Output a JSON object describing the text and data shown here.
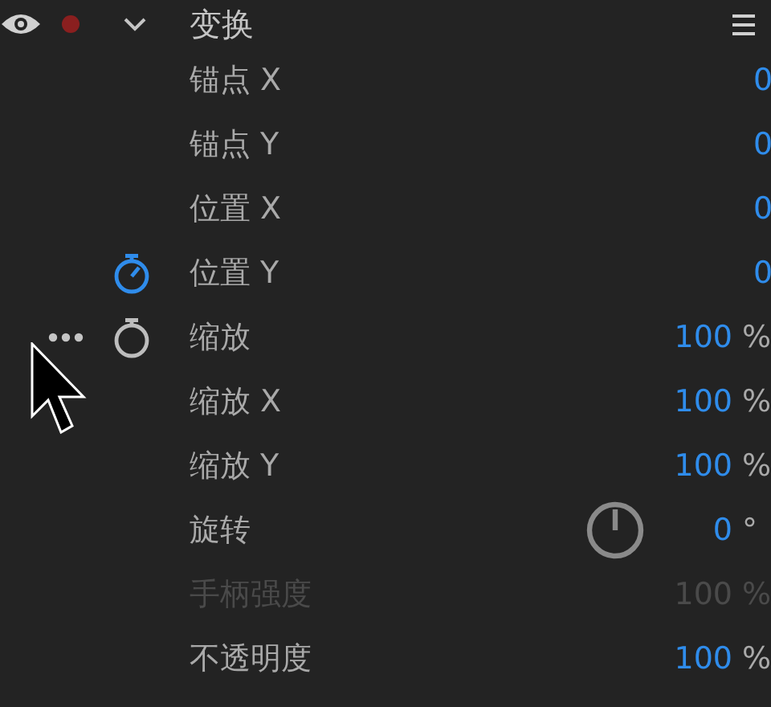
{
  "effect": {
    "title": "变换",
    "visible": true,
    "expanded": true
  },
  "properties": [
    {
      "label": "锚点 X",
      "value": "0",
      "disabled": false
    },
    {
      "label": "锚点 Y",
      "value": "0",
      "disabled": false
    },
    {
      "label": "位置 X",
      "value": "0",
      "disabled": false
    },
    {
      "label": "位置 Y",
      "value": "0",
      "stopwatch": {
        "on": true
      },
      "disabled": false
    },
    {
      "label": "缩放",
      "value": "100",
      "unit": "%",
      "stopwatch": {
        "on": false
      },
      "more": true,
      "disabled": false
    },
    {
      "label": "缩放 X",
      "value": "100",
      "unit": "%",
      "disabled": false
    },
    {
      "label": "缩放 Y",
      "value": "100",
      "unit": "%",
      "disabled": false
    },
    {
      "label": "旋转",
      "value": "0",
      "unit": "°",
      "dial": true,
      "disabled": false
    },
    {
      "label": "手柄强度",
      "value": "100",
      "unit": "%",
      "disabled": true
    },
    {
      "label": "不透明度",
      "value": "100",
      "unit": "%",
      "disabled": false
    }
  ]
}
